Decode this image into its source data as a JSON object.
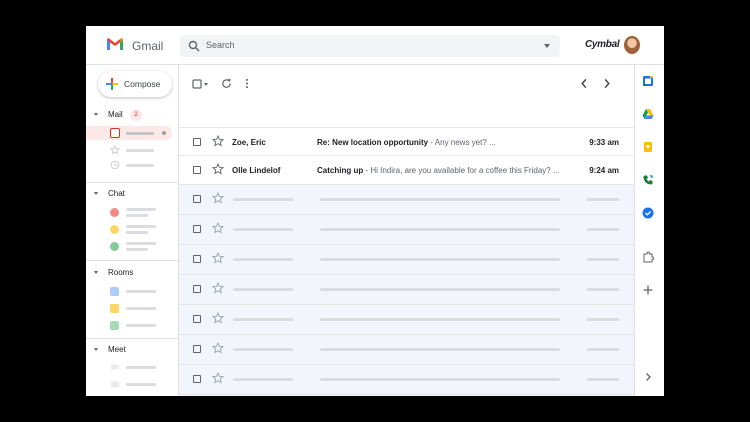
{
  "header": {
    "app_name": "Gmail",
    "search_placeholder": "Search",
    "brand": "Cymbal"
  },
  "sidebar": {
    "compose_label": "Compose",
    "sections": {
      "mail": {
        "label": "Mail",
        "badge": "2"
      },
      "chat": {
        "label": "Chat"
      },
      "rooms": {
        "label": "Rooms"
      },
      "meet": {
        "label": "Meet"
      }
    }
  },
  "messages": [
    {
      "sender": "Zoe, Eric",
      "subject": "Re: New location opportunity",
      "snippet": " - Any news yet? ...",
      "time": "9:33 am"
    },
    {
      "sender": "Olle Lindelof",
      "subject": "Catching up",
      "snippet": " - Hi Indira, are you available for a coffee this Friday? ...",
      "time": "9:24 am"
    }
  ],
  "colors": {
    "accent_red": "#d93025",
    "read_row_bg": "#f2f6fc",
    "chat_dots": [
      "#f28b82",
      "#fdd663",
      "#81c995"
    ],
    "room_squares": [
      "#aecbfa",
      "#fdd663",
      "#a8dab5"
    ]
  },
  "icons": {
    "header": [
      "gmail-logo",
      "search-icon",
      "chevron-down-icon",
      "avatar"
    ],
    "toolbar": [
      "checkbox-icon",
      "caret-down-icon",
      "refresh-icon",
      "more-vert-icon",
      "chevron-left-icon",
      "chevron-right-icon"
    ],
    "rail": [
      "calendar-icon",
      "drive-icon",
      "keep-icon",
      "voice-icon",
      "tasks-icon",
      "addons-icon",
      "plus-icon",
      "expand-icon"
    ]
  }
}
